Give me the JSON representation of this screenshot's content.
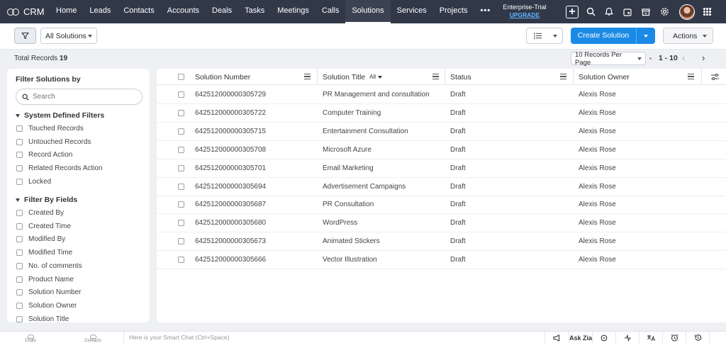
{
  "app": {
    "name": "CRM"
  },
  "nav": {
    "tabs": [
      "Home",
      "Leads",
      "Contacts",
      "Accounts",
      "Deals",
      "Tasks",
      "Meetings",
      "Calls",
      "Solutions",
      "Services",
      "Projects"
    ],
    "active_tab": "Solutions",
    "more_label": "•••",
    "trial_label": "Enterprise-Trial",
    "upgrade_label": "UPGRADE"
  },
  "toolbar": {
    "view_label": "All Solutions",
    "create_label": "Create Solution",
    "actions_label": "Actions"
  },
  "records": {
    "total_label": "Total Records",
    "total_count": "19",
    "per_page_label": "10 Records Per Page",
    "range": "1 - 10"
  },
  "sidebar": {
    "title": "Filter Solutions by",
    "search_placeholder": "Search",
    "system_section": "System Defined Filters",
    "system_filters": [
      "Touched Records",
      "Untouched Records",
      "Record Action",
      "Related Records Action",
      "Locked"
    ],
    "fields_section": "Filter By Fields",
    "field_filters": [
      "Created By",
      "Created Time",
      "Modified By",
      "Modified Time",
      "No. of comments",
      "Product Name",
      "Solution Number",
      "Solution Owner",
      "Solution Title"
    ]
  },
  "table": {
    "columns": {
      "number": "Solution Number",
      "title": "Solution Title",
      "title_filter": "All",
      "status": "Status",
      "owner": "Solution Owner"
    },
    "rows": [
      {
        "number": "642512000000305729",
        "title": "PR Management and consultation",
        "status": "Draft",
        "owner": "Alexis Rose"
      },
      {
        "number": "642512000000305722",
        "title": "Computer Training",
        "status": "Draft",
        "owner": "Alexis Rose"
      },
      {
        "number": "642512000000305715",
        "title": "Entertainment Consultation",
        "status": "Draft",
        "owner": "Alexis Rose"
      },
      {
        "number": "642512000000305708",
        "title": "Microsoft Azure",
        "status": "Draft",
        "owner": "Alexis Rose"
      },
      {
        "number": "642512000000305701",
        "title": "Email Marketing",
        "status": "Draft",
        "owner": "Alexis Rose"
      },
      {
        "number": "642512000000305694",
        "title": "Advertisement Campaigns",
        "status": "Draft",
        "owner": "Alexis Rose"
      },
      {
        "number": "642512000000305687",
        "title": "PR Consultation",
        "status": "Draft",
        "owner": "Alexis Rose"
      },
      {
        "number": "642512000000305680",
        "title": "WordPress",
        "status": "Draft",
        "owner": "Alexis Rose"
      },
      {
        "number": "642512000000305673",
        "title": "Animated Stickers",
        "status": "Draft",
        "owner": "Alexis Rose"
      },
      {
        "number": "642512000000305666",
        "title": "Vector Illustration",
        "status": "Draft",
        "owner": "Alexis Rose"
      }
    ]
  },
  "bottombar": {
    "chats_label": "Chats",
    "contacts_label": "Contacts",
    "smart_chat_placeholder": "Here is your Smart Chat (Ctrl+Space)",
    "ask_zia_label": "Ask Zia"
  },
  "colors": {
    "nav_bg": "#313949",
    "accent": "#1b8ae6",
    "page_bg": "#eef0f3"
  }
}
